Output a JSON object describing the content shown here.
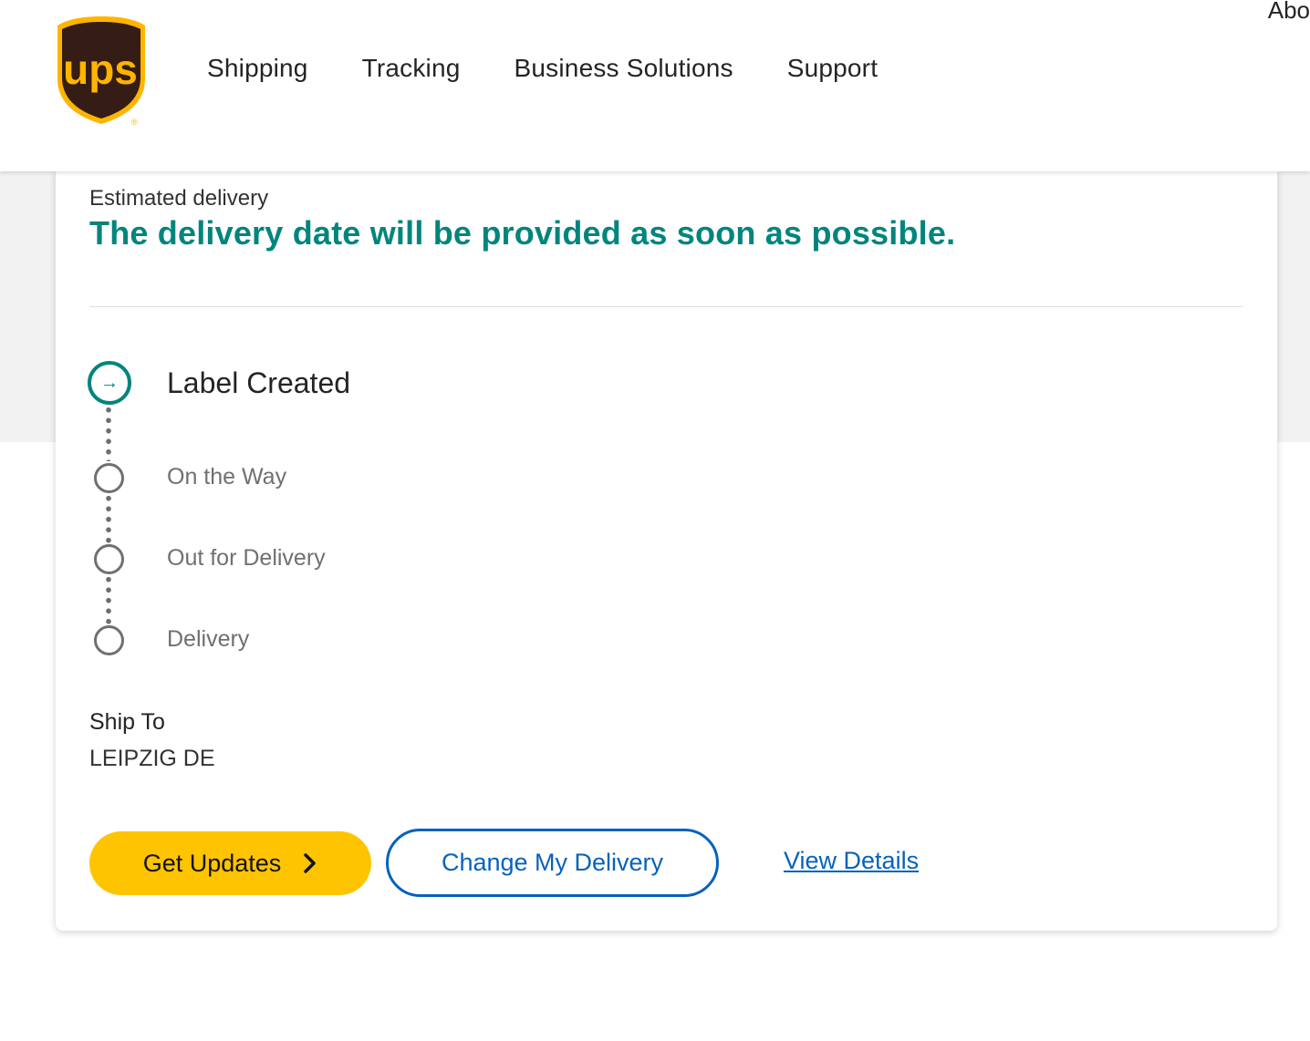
{
  "header": {
    "logo_text": "ups",
    "nav": [
      "Shipping",
      "Tracking",
      "Business Solutions",
      "Support"
    ],
    "top_right": "Abo"
  },
  "tracking": {
    "estimated_label": "Estimated delivery",
    "estimated_value": "The delivery date will be provided as soon as possible.",
    "steps": [
      {
        "label": "Label Created",
        "active": true
      },
      {
        "label": "On the Way",
        "active": false
      },
      {
        "label": "Out for Delivery",
        "active": false
      },
      {
        "label": "Delivery",
        "active": false
      }
    ],
    "ship_to_label": "Ship To",
    "ship_to_value": "LEIPZIG DE"
  },
  "actions": {
    "get_updates": "Get Updates",
    "change_delivery": "Change My Delivery",
    "view_details": "View Details"
  },
  "colors": {
    "brand_brown": "#351c15",
    "brand_gold": "#ffb500",
    "accent_teal": "#00857d",
    "button_yellow": "#ffc400",
    "link_blue": "#0662bb"
  },
  "icons": {
    "active_step": "arrow-right-icon",
    "button_chevron": "chevron-right-icon"
  }
}
